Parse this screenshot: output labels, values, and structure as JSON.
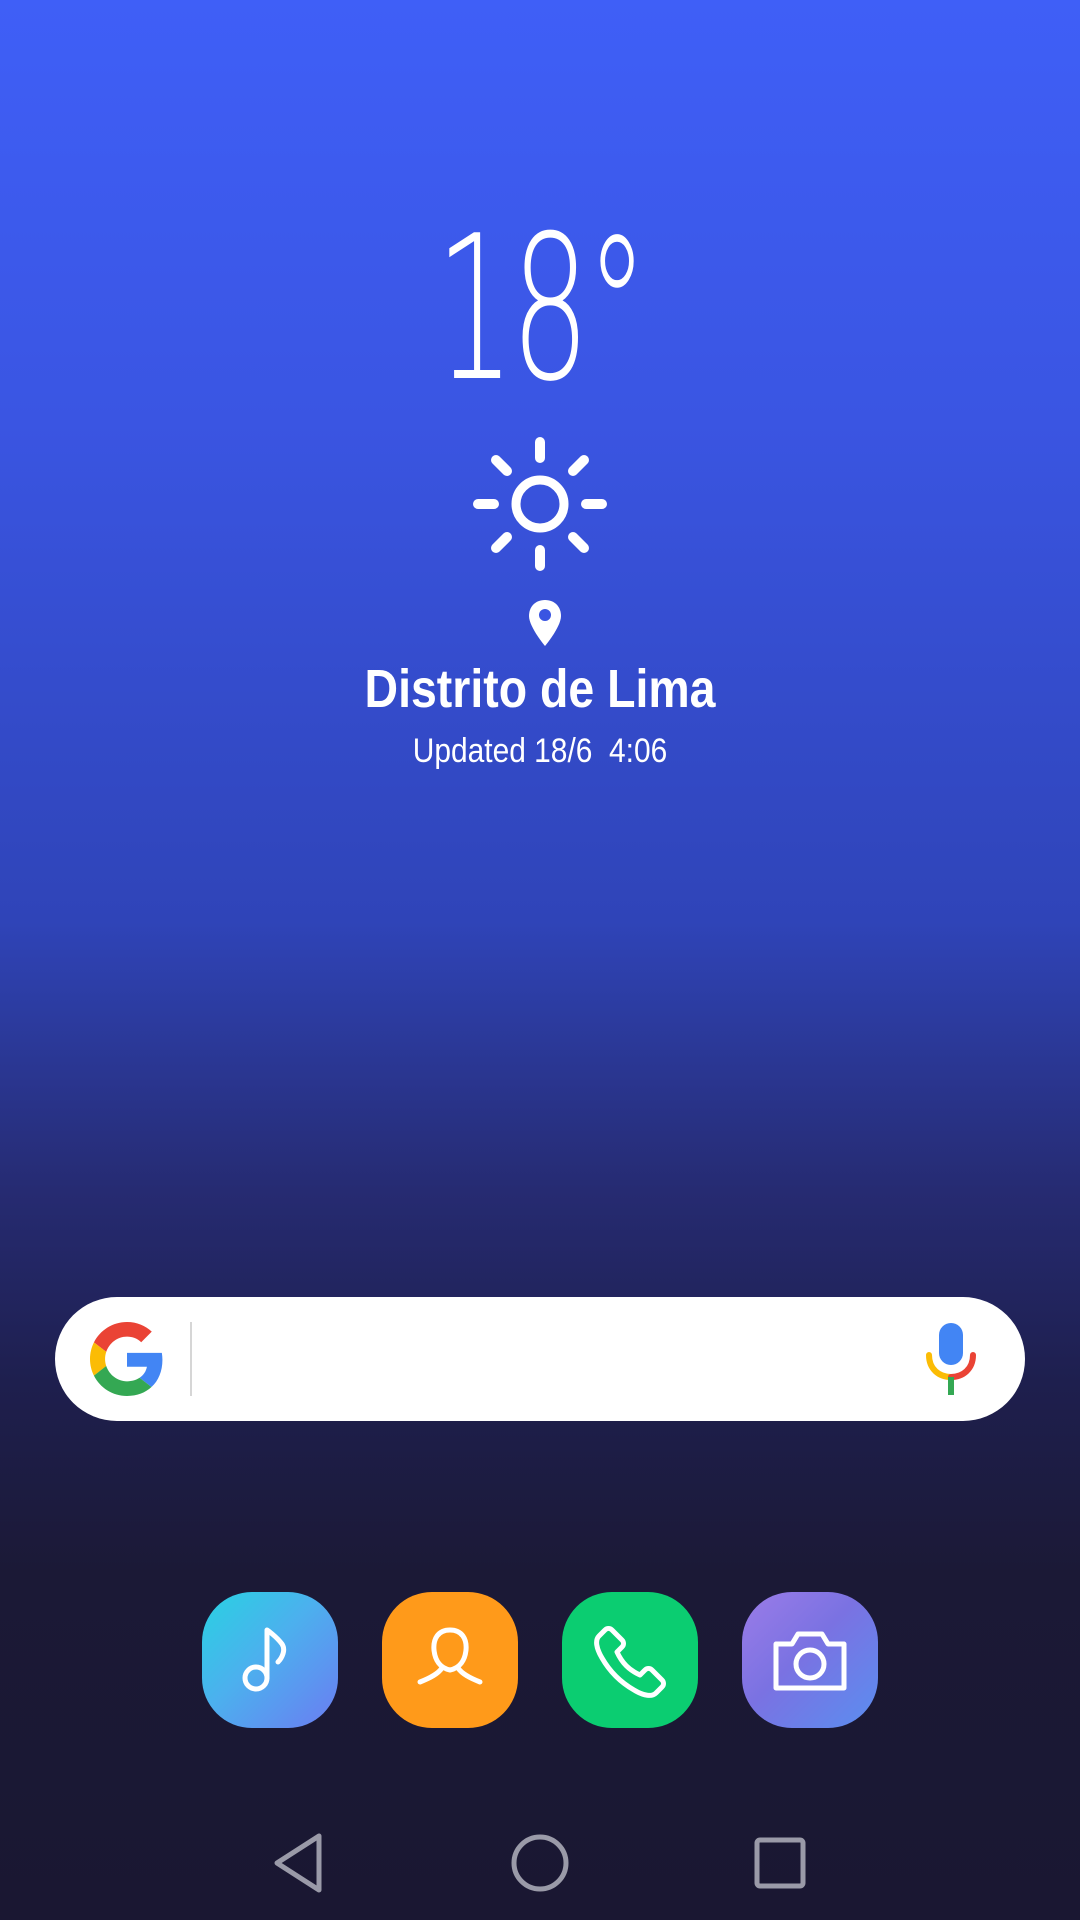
{
  "weather": {
    "temperature": "18°",
    "condition_icon": "sun-icon",
    "location_icon": "location-pin-icon",
    "location": "Distrito de Lima",
    "updated": "Updated 18/6  4:06"
  },
  "search_bar": {
    "logo_icon": "google-g-icon",
    "mic_icon": "microphone-icon",
    "value": "",
    "placeholder": ""
  },
  "dock": {
    "apps": [
      {
        "icon": "music-note-icon",
        "color": "#4cb0ee"
      },
      {
        "icon": "contact-person-icon",
        "color": "#ff9a1a"
      },
      {
        "icon": "phone-handset-icon",
        "color": "#0bcd71"
      },
      {
        "icon": "camera-icon",
        "color": "#7a72e2"
      }
    ]
  },
  "navigation": {
    "back_icon": "back-triangle-icon",
    "home_icon": "home-circle-icon",
    "recents_icon": "recents-square-icon"
  },
  "colors": {
    "background_top": "#3f5ff7",
    "background_bottom": "#1a1732",
    "google_blue": "#4285f4",
    "google_red": "#ea4335",
    "google_yellow": "#fbbc05",
    "google_green": "#34a853"
  }
}
